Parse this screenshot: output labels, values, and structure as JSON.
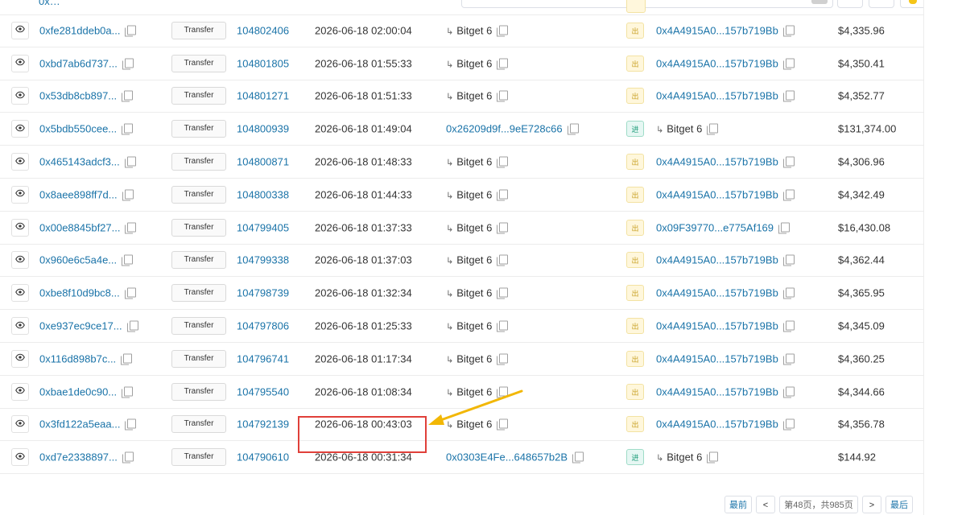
{
  "top_fragment": {
    "hash": "0x...(cut)"
  },
  "icons": {
    "view": "eye-icon",
    "copy": "copy-icon",
    "source": "arrow-icon",
    "search": "search-icon"
  },
  "colors": {
    "link": "#1a73a8",
    "out_badge_bg": "#fff7dc",
    "in_badge_bg": "#e6f7f3",
    "highlight": "#e0403a",
    "arrow": "#f2b705"
  },
  "rows": [
    {
      "hash": "0xfe281ddeb0a...",
      "method": "Transfer",
      "block": "104802406",
      "time": "2026-06-18 02:00:04",
      "from": "Bitget 6",
      "from_link": false,
      "dir": "出",
      "dir_type": "out",
      "to": "0x4A4915A0...157b719Bb",
      "to_link": true,
      "amount": "$4,335.96"
    },
    {
      "hash": "0xbd7ab6d737...",
      "method": "Transfer",
      "block": "104801805",
      "time": "2026-06-18 01:55:33",
      "from": "Bitget 6",
      "from_link": false,
      "dir": "出",
      "dir_type": "out",
      "to": "0x4A4915A0...157b719Bb",
      "to_link": true,
      "amount": "$4,350.41"
    },
    {
      "hash": "0x53db8cb897...",
      "method": "Transfer",
      "block": "104801271",
      "time": "2026-06-18 01:51:33",
      "from": "Bitget 6",
      "from_link": false,
      "dir": "出",
      "dir_type": "out",
      "to": "0x4A4915A0...157b719Bb",
      "to_link": true,
      "amount": "$4,352.77"
    },
    {
      "hash": "0x5bdb550cee...",
      "method": "Transfer",
      "block": "104800939",
      "time": "2026-06-18 01:49:04",
      "from": "0x26209d9f...9eE728c66",
      "from_link": true,
      "dir": "进",
      "dir_type": "in",
      "to": "Bitget 6",
      "to_link": false,
      "amount": "$131,374.00"
    },
    {
      "hash": "0x465143adcf3...",
      "method": "Transfer",
      "block": "104800871",
      "time": "2026-06-18 01:48:33",
      "from": "Bitget 6",
      "from_link": false,
      "dir": "出",
      "dir_type": "out",
      "to": "0x4A4915A0...157b719Bb",
      "to_link": true,
      "amount": "$4,306.96"
    },
    {
      "hash": "0x8aee898ff7d...",
      "method": "Transfer",
      "block": "104800338",
      "time": "2026-06-18 01:44:33",
      "from": "Bitget 6",
      "from_link": false,
      "dir": "出",
      "dir_type": "out",
      "to": "0x4A4915A0...157b719Bb",
      "to_link": true,
      "amount": "$4,342.49"
    },
    {
      "hash": "0x00e8845bf27...",
      "method": "Transfer",
      "block": "104799405",
      "time": "2026-06-18 01:37:33",
      "from": "Bitget 6",
      "from_link": false,
      "dir": "出",
      "dir_type": "out",
      "to": "0x09F39770...e775Af169",
      "to_link": true,
      "amount": "$16,430.08"
    },
    {
      "hash": "0x960e6c5a4e...",
      "method": "Transfer",
      "block": "104799338",
      "time": "2026-06-18 01:37:03",
      "from": "Bitget 6",
      "from_link": false,
      "dir": "出",
      "dir_type": "out",
      "to": "0x4A4915A0...157b719Bb",
      "to_link": true,
      "amount": "$4,362.44"
    },
    {
      "hash": "0xbe8f10d9bc8...",
      "method": "Transfer",
      "block": "104798739",
      "time": "2026-06-18 01:32:34",
      "from": "Bitget 6",
      "from_link": false,
      "dir": "出",
      "dir_type": "out",
      "to": "0x4A4915A0...157b719Bb",
      "to_link": true,
      "amount": "$4,365.95"
    },
    {
      "hash": "0xe937ec9ce17...",
      "method": "Transfer",
      "block": "104797806",
      "time": "2026-06-18 01:25:33",
      "from": "Bitget 6",
      "from_link": false,
      "dir": "出",
      "dir_type": "out",
      "to": "0x4A4915A0...157b719Bb",
      "to_link": true,
      "amount": "$4,345.09"
    },
    {
      "hash": "0x116d898b7c...",
      "method": "Transfer",
      "block": "104796741",
      "time": "2026-06-18 01:17:34",
      "from": "Bitget 6",
      "from_link": false,
      "dir": "出",
      "dir_type": "out",
      "to": "0x4A4915A0...157b719Bb",
      "to_link": true,
      "amount": "$4,360.25"
    },
    {
      "hash": "0xbae1de0c90...",
      "method": "Transfer",
      "block": "104795540",
      "time": "2026-06-18 01:08:34",
      "from": "Bitget 6",
      "from_link": false,
      "dir": "出",
      "dir_type": "out",
      "to": "0x4A4915A0...157b719Bb",
      "to_link": true,
      "amount": "$4,344.66"
    },
    {
      "hash": "0x3fd122a5eaa...",
      "method": "Transfer",
      "block": "104792139",
      "time": "2026-06-18 00:43:03",
      "from": "Bitget 6",
      "from_link": false,
      "dir": "出",
      "dir_type": "out",
      "to": "0x4A4915A0...157b719Bb",
      "to_link": true,
      "amount": "$4,356.78"
    },
    {
      "hash": "0xd7e2338897...",
      "method": "Transfer",
      "block": "104790610",
      "time": "2026-06-18 00:31:34",
      "from": "0x0303E4Fe...648657b2B",
      "from_link": true,
      "dir": "进",
      "dir_type": "in",
      "to": "Bitget 6",
      "to_link": false,
      "amount": "$144.92"
    }
  ],
  "pagination": {
    "first": "最前",
    "prev": "<",
    "info": "第48页，共985页",
    "next": ">",
    "last": "最后"
  }
}
